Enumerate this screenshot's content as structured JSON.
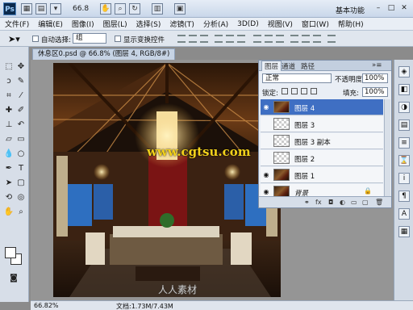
{
  "app": {
    "logo": "Ps",
    "zoom": "66.8",
    "workspace": "基本功能",
    "window_buttons": [
      "–",
      "□",
      "✕"
    ]
  },
  "menu": [
    "文件(F)",
    "编辑(E)",
    "图像(I)",
    "图层(L)",
    "选择(S)",
    "滤镜(T)",
    "分析(A)",
    "3D(D)",
    "视图(V)",
    "窗口(W)",
    "帮助(H)"
  ],
  "options": {
    "auto_select_label": "自动选择:",
    "auto_select_value": "组",
    "show_transform_label": "显示变换控件"
  },
  "document": {
    "tab_title": "休息区0.psd @ 66.8% (图层 4, RGB/8#)",
    "watermark": "www.cgtsu.com",
    "logo_text": "人人素材"
  },
  "status": {
    "zoom": "66.82%",
    "doc_size": "文档:1.73M/7.43M"
  },
  "layers_panel": {
    "tabs": [
      "图层",
      "通道",
      "路径"
    ],
    "blend_mode": "正常",
    "opacity_label": "不透明度:",
    "opacity_value": "100%",
    "lock_label": "锁定:",
    "fill_label": "填充:",
    "fill_value": "100%",
    "layers": [
      {
        "name": "图层 4",
        "selected": true,
        "thumb": "image"
      },
      {
        "name": "图层 3",
        "selected": false,
        "thumb": "transparent"
      },
      {
        "name": "图层 3 副本",
        "selected": false,
        "thumb": "transparent"
      },
      {
        "name": "图层 2",
        "selected": false,
        "thumb": "transparent"
      },
      {
        "name": "图层 1",
        "selected": false,
        "thumb": "image"
      },
      {
        "name": "背景",
        "selected": false,
        "thumb": "image",
        "locked": true
      }
    ],
    "footer_icons": [
      "link-icon",
      "fx-icon",
      "mask-icon",
      "adjustment-icon",
      "folder-icon",
      "new-layer-icon",
      "trash-icon"
    ]
  },
  "colors": {
    "accent_selected": "#3f6fc3",
    "watermark": "#f2d11b"
  }
}
